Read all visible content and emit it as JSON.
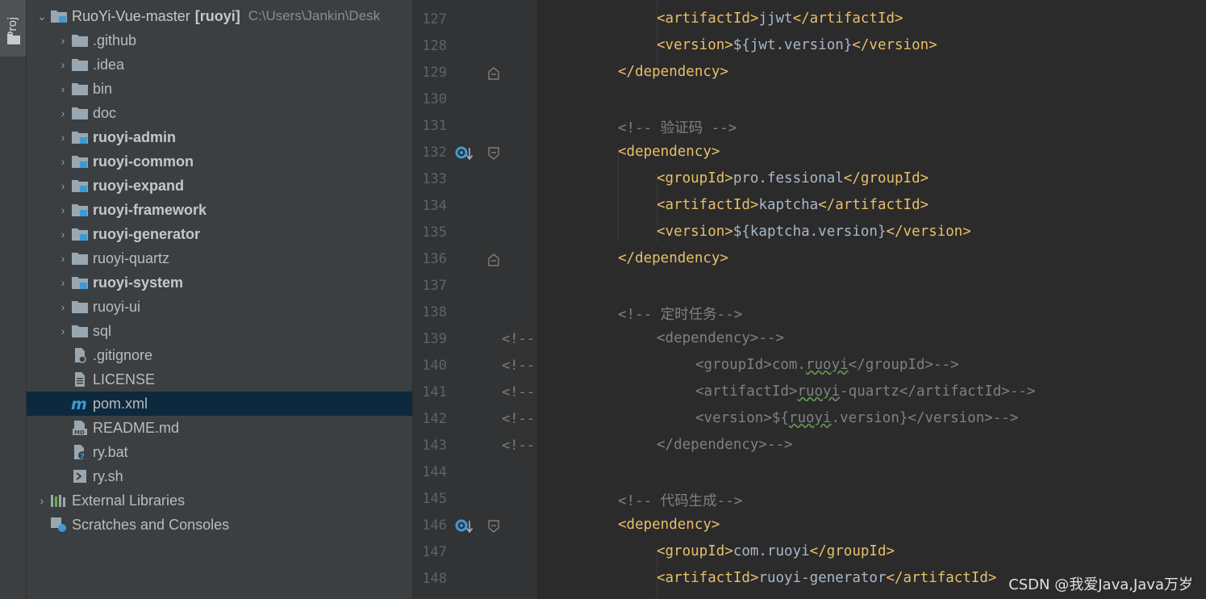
{
  "sidebar": {
    "stripe_label": "Proj"
  },
  "tree": {
    "root": {
      "name": "RuoYi-Vue-master",
      "module": "[ruoyi]",
      "path": "C:\\Users\\Jankin\\Desk"
    },
    "items": [
      {
        "label": ".github",
        "kind": "folder",
        "bold": false
      },
      {
        "label": ".idea",
        "kind": "folder",
        "bold": false
      },
      {
        "label": "bin",
        "kind": "folder",
        "bold": false
      },
      {
        "label": "doc",
        "kind": "folder",
        "bold": false
      },
      {
        "label": "ruoyi-admin",
        "kind": "module-folder",
        "bold": true
      },
      {
        "label": "ruoyi-common",
        "kind": "module-folder",
        "bold": true
      },
      {
        "label": "ruoyi-expand",
        "kind": "module-folder",
        "bold": true
      },
      {
        "label": "ruoyi-framework",
        "kind": "module-folder",
        "bold": true
      },
      {
        "label": "ruoyi-generator",
        "kind": "module-folder",
        "bold": true
      },
      {
        "label": "ruoyi-quartz",
        "kind": "folder",
        "bold": false
      },
      {
        "label": "ruoyi-system",
        "kind": "module-folder",
        "bold": true
      },
      {
        "label": "ruoyi-ui",
        "kind": "folder",
        "bold": false
      },
      {
        "label": "sql",
        "kind": "folder",
        "bold": false
      },
      {
        "label": ".gitignore",
        "kind": "gitignore-file",
        "bold": false
      },
      {
        "label": "LICENSE",
        "kind": "text-file",
        "bold": false
      },
      {
        "label": "pom.xml",
        "kind": "maven-file",
        "bold": false,
        "selected": true
      },
      {
        "label": "README.md",
        "kind": "markdown-file",
        "bold": false
      },
      {
        "label": "ry.bat",
        "kind": "bat-file",
        "bold": false
      },
      {
        "label": "ry.sh",
        "kind": "shell-file",
        "bold": false
      }
    ],
    "external_libraries": "External Libraries",
    "scratches": "Scratches and Consoles"
  },
  "editor": {
    "lines": [
      {
        "num": "127",
        "code": "<artifactId>jjwt</artifactId>"
      },
      {
        "num": "128",
        "code": "<version>${jwt.version}</version>"
      },
      {
        "num": "129",
        "code": "</dependency>"
      },
      {
        "num": "130",
        "code": ""
      },
      {
        "num": "131",
        "code": "<!-- 验证码 -->"
      },
      {
        "num": "132",
        "code": "<dependency>"
      },
      {
        "num": "133",
        "code": "<groupId>pro.fessional</groupId>"
      },
      {
        "num": "134",
        "code": "<artifactId>kaptcha</artifactId>"
      },
      {
        "num": "135",
        "code": "<version>${kaptcha.version}</version>"
      },
      {
        "num": "136",
        "code": "</dependency>"
      },
      {
        "num": "137",
        "code": ""
      },
      {
        "num": "138",
        "code": "<!-- 定时任务-->"
      },
      {
        "num": "139",
        "code": "<dependency>-->"
      },
      {
        "num": "140",
        "code": "<groupId>com.ruoyi</groupId>-->"
      },
      {
        "num": "141",
        "code": "<artifactId>ruoyi-quartz</artifactId>-->"
      },
      {
        "num": "142",
        "code": "<version>${ruoyi.version}</version>-->"
      },
      {
        "num": "143",
        "code": "</dependency>-->"
      },
      {
        "num": "144",
        "code": ""
      },
      {
        "num": "145",
        "code": "<!-- 代码生成-->"
      },
      {
        "num": "146",
        "code": "<dependency>"
      },
      {
        "num": "147",
        "code": "<groupId>com.ruoyi</groupId>"
      },
      {
        "num": "148",
        "code": "<artifactId>ruoyi-generator</artifactId>"
      }
    ],
    "comment_prefix": "<!--"
  },
  "watermark": "CSDN @我爱Java,Java万岁",
  "colors": {
    "tag": "#e8bf6a",
    "text": "#a9b7c6",
    "comment": "#808080",
    "selection": "#0d293e",
    "module_badge": "#3d9ad6"
  }
}
